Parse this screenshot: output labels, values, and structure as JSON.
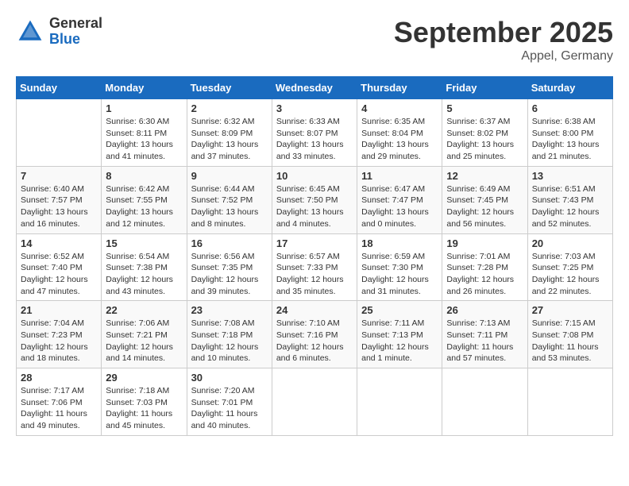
{
  "logo": {
    "general": "General",
    "blue": "Blue"
  },
  "header": {
    "month": "September 2025",
    "location": "Appel, Germany"
  },
  "days_of_week": [
    "Sunday",
    "Monday",
    "Tuesday",
    "Wednesday",
    "Thursday",
    "Friday",
    "Saturday"
  ],
  "weeks": [
    [
      {
        "num": "",
        "detail": ""
      },
      {
        "num": "1",
        "detail": "Sunrise: 6:30 AM\nSunset: 8:11 PM\nDaylight: 13 hours\nand 41 minutes."
      },
      {
        "num": "2",
        "detail": "Sunrise: 6:32 AM\nSunset: 8:09 PM\nDaylight: 13 hours\nand 37 minutes."
      },
      {
        "num": "3",
        "detail": "Sunrise: 6:33 AM\nSunset: 8:07 PM\nDaylight: 13 hours\nand 33 minutes."
      },
      {
        "num": "4",
        "detail": "Sunrise: 6:35 AM\nSunset: 8:04 PM\nDaylight: 13 hours\nand 29 minutes."
      },
      {
        "num": "5",
        "detail": "Sunrise: 6:37 AM\nSunset: 8:02 PM\nDaylight: 13 hours\nand 25 minutes."
      },
      {
        "num": "6",
        "detail": "Sunrise: 6:38 AM\nSunset: 8:00 PM\nDaylight: 13 hours\nand 21 minutes."
      }
    ],
    [
      {
        "num": "7",
        "detail": "Sunrise: 6:40 AM\nSunset: 7:57 PM\nDaylight: 13 hours\nand 16 minutes."
      },
      {
        "num": "8",
        "detail": "Sunrise: 6:42 AM\nSunset: 7:55 PM\nDaylight: 13 hours\nand 12 minutes."
      },
      {
        "num": "9",
        "detail": "Sunrise: 6:44 AM\nSunset: 7:52 PM\nDaylight: 13 hours\nand 8 minutes."
      },
      {
        "num": "10",
        "detail": "Sunrise: 6:45 AM\nSunset: 7:50 PM\nDaylight: 13 hours\nand 4 minutes."
      },
      {
        "num": "11",
        "detail": "Sunrise: 6:47 AM\nSunset: 7:47 PM\nDaylight: 13 hours\nand 0 minutes."
      },
      {
        "num": "12",
        "detail": "Sunrise: 6:49 AM\nSunset: 7:45 PM\nDaylight: 12 hours\nand 56 minutes."
      },
      {
        "num": "13",
        "detail": "Sunrise: 6:51 AM\nSunset: 7:43 PM\nDaylight: 12 hours\nand 52 minutes."
      }
    ],
    [
      {
        "num": "14",
        "detail": "Sunrise: 6:52 AM\nSunset: 7:40 PM\nDaylight: 12 hours\nand 47 minutes."
      },
      {
        "num": "15",
        "detail": "Sunrise: 6:54 AM\nSunset: 7:38 PM\nDaylight: 12 hours\nand 43 minutes."
      },
      {
        "num": "16",
        "detail": "Sunrise: 6:56 AM\nSunset: 7:35 PM\nDaylight: 12 hours\nand 39 minutes."
      },
      {
        "num": "17",
        "detail": "Sunrise: 6:57 AM\nSunset: 7:33 PM\nDaylight: 12 hours\nand 35 minutes."
      },
      {
        "num": "18",
        "detail": "Sunrise: 6:59 AM\nSunset: 7:30 PM\nDaylight: 12 hours\nand 31 minutes."
      },
      {
        "num": "19",
        "detail": "Sunrise: 7:01 AM\nSunset: 7:28 PM\nDaylight: 12 hours\nand 26 minutes."
      },
      {
        "num": "20",
        "detail": "Sunrise: 7:03 AM\nSunset: 7:25 PM\nDaylight: 12 hours\nand 22 minutes."
      }
    ],
    [
      {
        "num": "21",
        "detail": "Sunrise: 7:04 AM\nSunset: 7:23 PM\nDaylight: 12 hours\nand 18 minutes."
      },
      {
        "num": "22",
        "detail": "Sunrise: 7:06 AM\nSunset: 7:21 PM\nDaylight: 12 hours\nand 14 minutes."
      },
      {
        "num": "23",
        "detail": "Sunrise: 7:08 AM\nSunset: 7:18 PM\nDaylight: 12 hours\nand 10 minutes."
      },
      {
        "num": "24",
        "detail": "Sunrise: 7:10 AM\nSunset: 7:16 PM\nDaylight: 12 hours\nand 6 minutes."
      },
      {
        "num": "25",
        "detail": "Sunrise: 7:11 AM\nSunset: 7:13 PM\nDaylight: 12 hours\nand 1 minute."
      },
      {
        "num": "26",
        "detail": "Sunrise: 7:13 AM\nSunset: 7:11 PM\nDaylight: 11 hours\nand 57 minutes."
      },
      {
        "num": "27",
        "detail": "Sunrise: 7:15 AM\nSunset: 7:08 PM\nDaylight: 11 hours\nand 53 minutes."
      }
    ],
    [
      {
        "num": "28",
        "detail": "Sunrise: 7:17 AM\nSunset: 7:06 PM\nDaylight: 11 hours\nand 49 minutes."
      },
      {
        "num": "29",
        "detail": "Sunrise: 7:18 AM\nSunset: 7:03 PM\nDaylight: 11 hours\nand 45 minutes."
      },
      {
        "num": "30",
        "detail": "Sunrise: 7:20 AM\nSunset: 7:01 PM\nDaylight: 11 hours\nand 40 minutes."
      },
      {
        "num": "",
        "detail": ""
      },
      {
        "num": "",
        "detail": ""
      },
      {
        "num": "",
        "detail": ""
      },
      {
        "num": "",
        "detail": ""
      }
    ]
  ]
}
